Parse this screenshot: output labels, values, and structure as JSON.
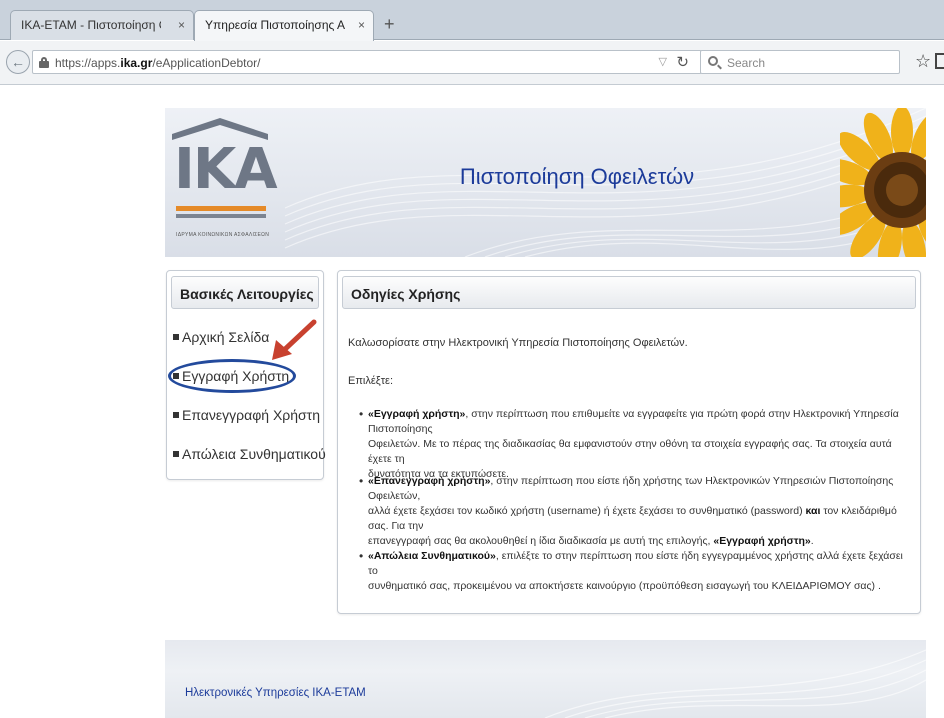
{
  "browser": {
    "tabs": [
      {
        "title": "IKA-ETAM - Πιστοποίηση Οφε...",
        "active": false
      },
      {
        "title": "Υπηρεσία Πιστοποίησης Ατομ...",
        "active": true
      }
    ],
    "tab_close_glyph": "×",
    "new_tab_glyph": "+",
    "url_prefix": "https://apps.",
    "url_domain": "ika.gr",
    "url_path": "/eApplicationDebtor/",
    "search_placeholder": "Search",
    "icons": [
      "back-icon",
      "lock-icon",
      "dropdown-icon",
      "reload-icon",
      "search-icon",
      "bookmark-star-icon",
      "bookmarks-icon"
    ]
  },
  "header": {
    "logo_text": "IKA",
    "logo_caption": "ΙΔΡΥΜΑ ΚΟΙΝΩΝΙΚΩΝ ΑΣΦΑΛΙΣΕΩΝ",
    "title": "Πιστοποίηση Οφειλετών"
  },
  "sidebar": {
    "title": "Βασικές Λειτουργίες",
    "items": [
      {
        "label": "Αρχική Σελίδα"
      },
      {
        "label": "Εγγραφή Χρήστη"
      },
      {
        "label": "Επανεγγραφή Χρήστη"
      },
      {
        "label": "Απώλεια Συνθηματικού"
      }
    ]
  },
  "content": {
    "title": "Οδηγίες Χρήσης",
    "welcome": "Καλωσορίσατε στην Ηλεκτρονική Υπηρεσία Πιστοποίησης Οφειλετών.",
    "choose": "Επιλέξτε:",
    "bullets": [
      {
        "bold": "«Εγγραφή χρήστη»",
        "line1": ", στην περίπτωση που επιθυμείτε να εγγραφείτε για πρώτη φορά στην Ηλεκτρονική Υπηρεσία Πιστοποίησης",
        "line2": "Οφειλετών. Με το πέρας της διαδικασίας θα εμφανιστούν στην οθόνη τα στοιχεία εγγραφής σας. Τα στοιχεία αυτά έχετε τη",
        "line3": "δυνατότητα να τα εκτυπώσετε."
      },
      {
        "bold": "«Επανεγγραφή χρήστη»",
        "line1": ", στην περίπτωση που είστε ήδη χρήστης των Ηλεκτρονικών Υπηρεσιών Πιστοποίησης Οφειλετών,",
        "line2a": "αλλά έχετε ξεχάσει τον κωδικό χρήστη (username) ή έχετε ξεχάσει το συνθηματικό (password) ",
        "line2_bold": "και",
        "line2b": " τον κλειδάριθμό σας. Για την",
        "line3a": "επανεγγραφή σας θα ακολουθηθεί η ίδια διαδικασία με αυτή της επιλογής, ",
        "line3_bold": "«Εγγραφή χρήστη»",
        "line3b": "."
      },
      {
        "bold": "«Απώλεια Συνθηματικού»",
        "line1": ", επιλέξτε το στην περίπτωση που είστε ήδη εγγεγραμμένος χρήστης αλλά έχετε ξεχάσει το",
        "line2": "συνθηματικό σας, προκειμένου να αποκτήσετε καινούργιο (προϋπόθεση εισαγωγή του ΚΛΕΙΔΑΡΙΘΜΟΥ σας) ."
      }
    ]
  },
  "footer": {
    "text": "Ηλεκτρονικές Υπηρεσίες ΙΚΑ-ΕΤΑΜ"
  },
  "colors": {
    "title_blue": "#1c3b9a",
    "logo_orange": "#e58a28",
    "annotation_red": "#c8412f",
    "annotation_blue": "#234a9c"
  }
}
